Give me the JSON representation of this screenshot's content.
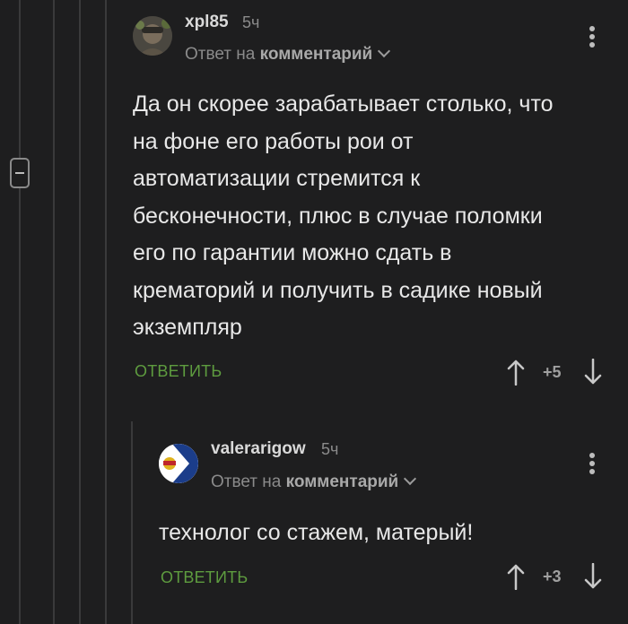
{
  "comments": [
    {
      "username": "xpl85",
      "time": "5ч",
      "reply_prefix": "Ответ на",
      "reply_target": "комментарий",
      "body": "Да он скорее зарабатывает столько, что на фоне его работы рои от автоматизации стремится к бесконечности, плюс в случае поломки его по гарантии можно сдать в крематорий и получить в садике новый экземпляр",
      "reply_label": "ОТВЕТИТЬ",
      "rating": "+5"
    },
    {
      "username": "valerarigow",
      "time": "5ч",
      "reply_prefix": "Ответ на",
      "reply_target": "комментарий",
      "body": "технолог со стажем, матерый!",
      "reply_label": "ОТВЕТИТЬ",
      "rating": "+3"
    }
  ],
  "icons": {
    "collapse": "minus-box-icon",
    "menu": "more-vertical-icon",
    "upvote": "arrow-up-icon",
    "downvote": "arrow-down-icon",
    "expand_reply": "chevron-down-icon"
  },
  "colors": {
    "background": "#1e1e1f",
    "accent_green": "#5e9c3f",
    "thread_line": "#3a3a3b"
  }
}
